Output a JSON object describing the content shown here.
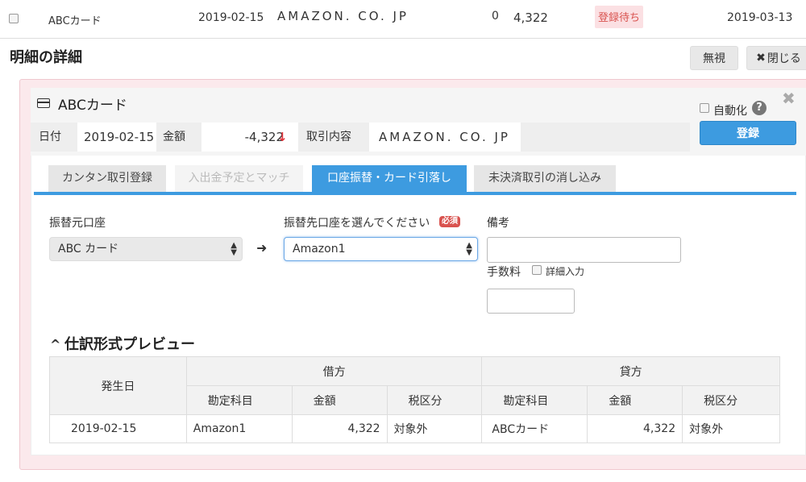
{
  "transaction": {
    "card": "ABCカード",
    "date": "2019-02-15",
    "description": "AMAZON. CO. JP",
    "zero": "0",
    "amount": "4,322",
    "status_badge": "登録待ち",
    "due_date": "2019-03-13"
  },
  "detail": {
    "title": "明細の詳細",
    "ignore_label": "無視",
    "close_label": "閉じる"
  },
  "panel": {
    "title": "ABCカード",
    "auto_label": "自動化",
    "help_glyph": "?",
    "register_label": "登録",
    "info": {
      "date_label": "日付",
      "date_value": "2019-02-15",
      "amount_label": "金額",
      "amount_value": "-4,322",
      "desc_label": "取引内容",
      "desc_value": "AMAZON. CO. JP"
    }
  },
  "tabs": [
    {
      "label": "カンタン取引登録",
      "state": "normal"
    },
    {
      "label": "入出金予定とマッチ",
      "state": "disabled"
    },
    {
      "label": "口座振替・カード引落し",
      "state": "active"
    },
    {
      "label": "未決済取引の消し込み",
      "state": "normal"
    }
  ],
  "form": {
    "from_label": "振替元口座",
    "from_value": "ABC カード",
    "to_label": "振替先口座を選んでください",
    "required_badge": "必須",
    "to_value": "Amazon1",
    "memo_label": "備考",
    "memo_value": "",
    "fee_label": "手数料",
    "detail_entry_label": "詳細入力",
    "fee_value": ""
  },
  "preview": {
    "title": "仕訳形式プレビュー",
    "headers": {
      "date": "発生日",
      "debit": "借方",
      "credit": "貸方",
      "account": "勘定科目",
      "amount": "金額",
      "tax": "税区分"
    },
    "row": {
      "date": "2019-02-15",
      "debit_account": "Amazon1",
      "debit_amount": "4,322",
      "debit_tax": "対象外",
      "credit_account": "ABCカード",
      "credit_amount": "4,322",
      "credit_tax": "対象外"
    }
  },
  "colors": {
    "accent": "#3d9be0",
    "panel_bg": "#fbe9ec",
    "badge_bg": "#fbe0e3",
    "down_arrow": "#e2343c"
  }
}
